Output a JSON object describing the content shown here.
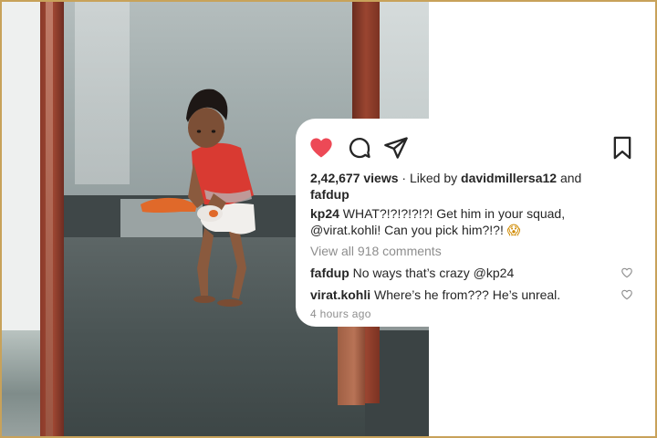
{
  "colors": {
    "heart_active": "#ed4956",
    "text_primary": "#262626",
    "text_secondary": "#8e8e8e",
    "border_frame": "#c8a25a"
  },
  "post": {
    "icons": [
      "heart-icon",
      "comment-icon",
      "share-icon",
      "bookmark-icon"
    ],
    "views": "2,42,677 views",
    "liked_by_prefix": " · Liked by ",
    "liked_by_user": "davidmillersa12",
    "liked_by_and": " and",
    "liked_by_second": "fafdup",
    "caption": {
      "username": "kp24",
      "text_1": " WHAT?!?!?!?!?! Get him in your squad,",
      "text_2": "@virat.kohli! Can you pick him?!?! ",
      "emoji": "😱"
    },
    "view_all_comments": "View all 918 comments",
    "comments": [
      {
        "username": "fafdup",
        "text": " No ways that’s crazy @kp24"
      },
      {
        "username": "virat.kohli",
        "text": " Where’s he from??? He’s unreal."
      }
    ],
    "timestamp": "4 hours ago"
  }
}
